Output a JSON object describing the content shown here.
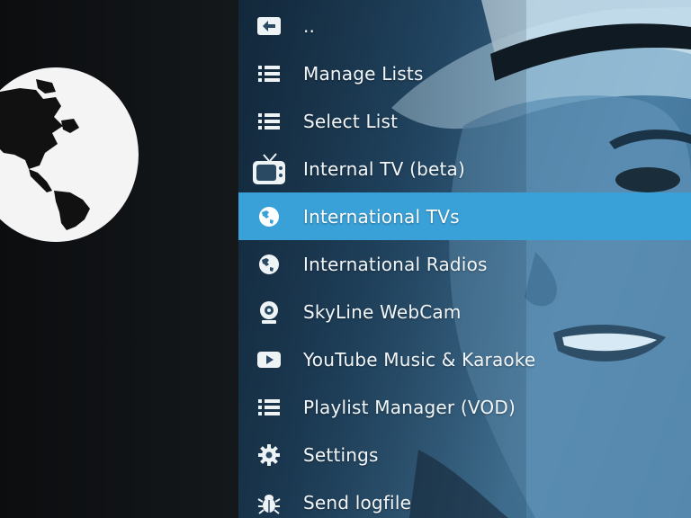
{
  "menu": {
    "items": [
      {
        "label": "..",
        "icon": "back-arrow-icon"
      },
      {
        "label": "Manage Lists",
        "icon": "list-icon"
      },
      {
        "label": "Select List",
        "icon": "list-icon"
      },
      {
        "label": "Internal TV (beta)",
        "icon": "tv-icon"
      },
      {
        "label": "International TVs",
        "icon": "globe-icon",
        "selected": true
      },
      {
        "label": "International Radios",
        "icon": "globe-icon"
      },
      {
        "label": "SkyLine WebCam",
        "icon": "webcam-icon"
      },
      {
        "label": "YouTube Music & Karaoke",
        "icon": "youtube-icon"
      },
      {
        "label": "Playlist Manager (VOD)",
        "icon": "list-icon"
      },
      {
        "label": "Settings",
        "icon": "gear-icon"
      },
      {
        "label": "Send logfile",
        "icon": "bug-icon"
      }
    ]
  },
  "colors": {
    "selection": "#3aa1d8",
    "text": "#f2f6f8",
    "left_panel": "#101316"
  }
}
